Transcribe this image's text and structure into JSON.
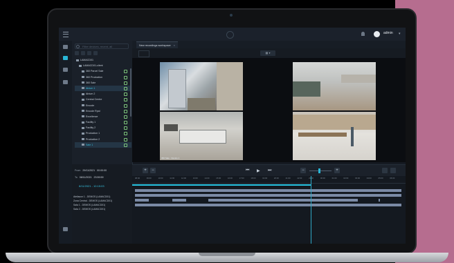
{
  "app": {
    "user": "admin",
    "search_placeholder": "Filter devices, recent, all",
    "tab_title": "New recordings workspace"
  },
  "tree": {
    "root": "LAMACD01",
    "group": "LAMACD01-client",
    "items": [
      {
        "label": "360 Parcel Sale",
        "selected": false
      },
      {
        "label": "360 Production",
        "selected": false
      },
      {
        "label": "360 Sale",
        "selected": false
      },
      {
        "label": "Atrium 1",
        "selected": true
      },
      {
        "label": "Atrium 2",
        "selected": false
      },
      {
        "label": "Central Centre",
        "selected": false
      },
      {
        "label": "Encode",
        "selected": false
      },
      {
        "label": "Encode Rpal",
        "selected": false
      },
      {
        "label": "Excellence",
        "selected": false
      },
      {
        "label": "Facility 1",
        "selected": false
      },
      {
        "label": "Facility 2",
        "selected": false
      },
      {
        "label": "Production 1",
        "selected": false
      },
      {
        "label": "Production 2",
        "selected": false
      },
      {
        "label": "Sale 1",
        "selected": true
      }
    ]
  },
  "playback": {
    "from_label": "From",
    "from_date": "29/11/2021",
    "from_time": "00:00:00",
    "to_label": "To",
    "to_date": "08/11/2021",
    "to_time": "23:59:59",
    "range": "8/11/2021 - 10:15:03"
  },
  "tracks": [
    {
      "label": "Ateliacon 1 - DEMOS (LAMACD01)"
    },
    {
      "label": "Zona Central - DEMOS (LAMACD01)"
    },
    {
      "label": "Sala 1 - DEMOS (LAMACD01)"
    },
    {
      "label": "Sala 2 - DEMOS (LAMACD01)"
    }
  ],
  "ruler_ticks": [
    "08:00",
    "09:00",
    "10:00",
    "11:00",
    "12:00",
    "13:00",
    "14:00",
    "15:00",
    "16:00",
    "17:00",
    "18:00",
    "19:00",
    "20:00",
    "21:00",
    "22:00",
    "23:00",
    "00:00",
    "01:00",
    "02:00",
    "03:00",
    "04:00",
    "05:00",
    "06:00"
  ],
  "video": {
    "tile_labels": [
      "",
      "",
      "360 Sale - Device 1",
      ""
    ]
  },
  "colors": {
    "accent": "#29b6d6",
    "track": "#7b8aa5",
    "pink_panel": "#b66d8f"
  }
}
